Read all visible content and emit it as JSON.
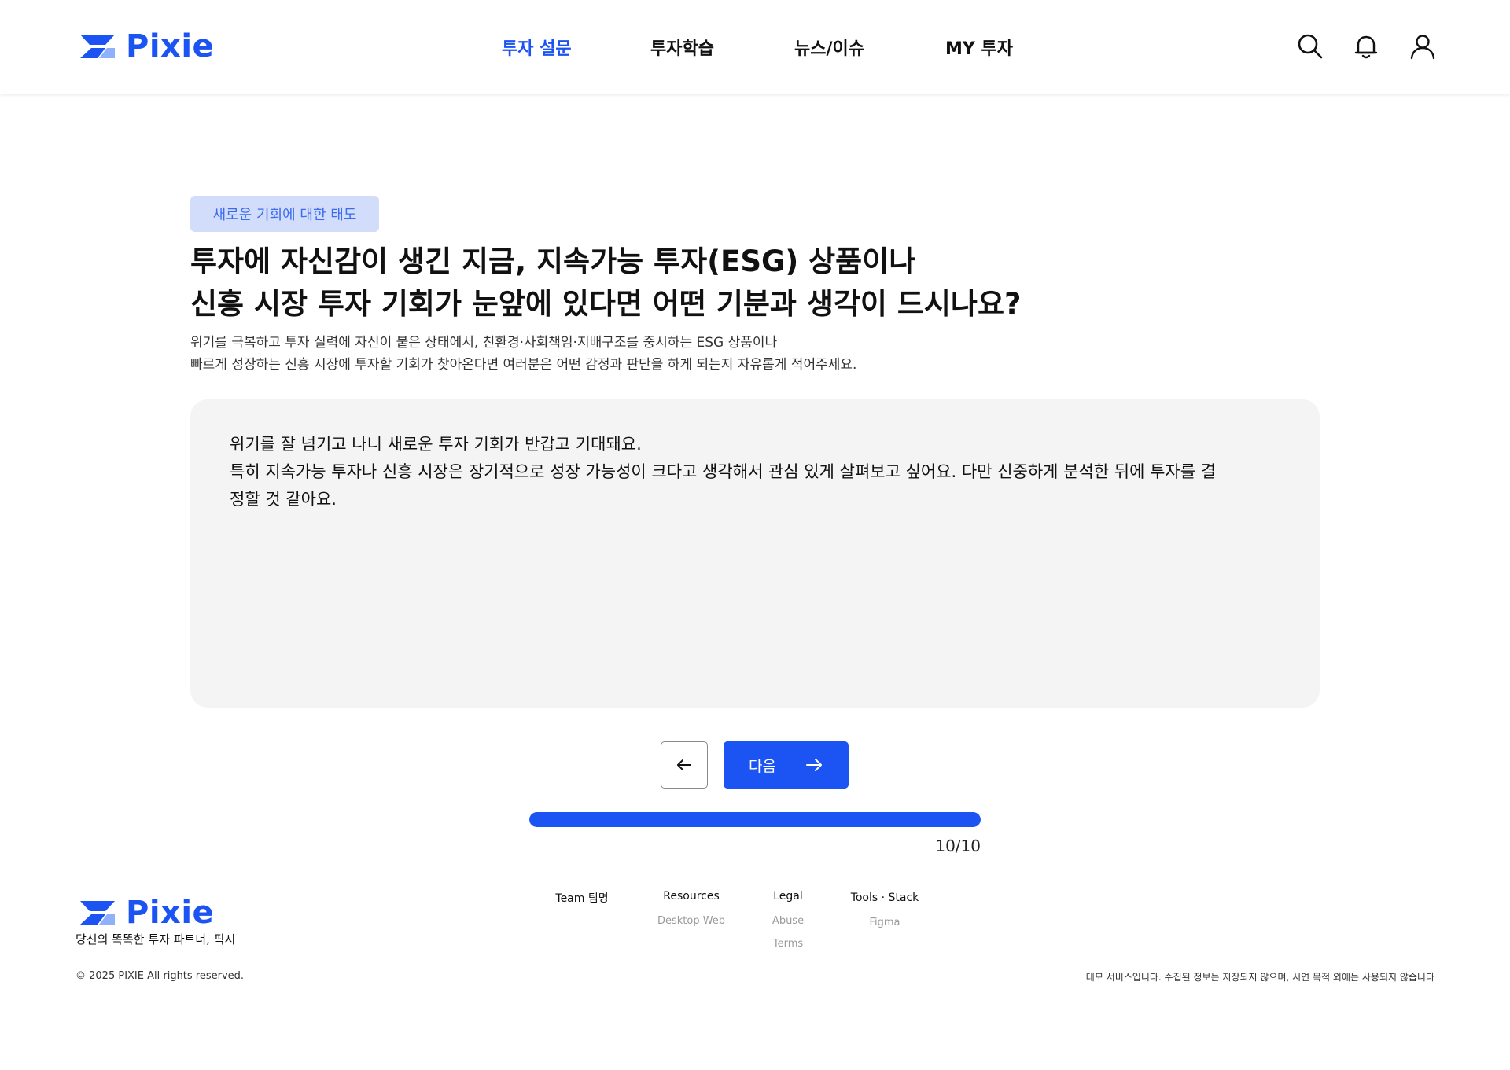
{
  "brand": {
    "name": "Pixie",
    "accent": "#1c54f3",
    "light_accent": "#d2ddfb"
  },
  "nav": {
    "items": [
      {
        "label": "투자 설문",
        "active": true
      },
      {
        "label": "투자학습",
        "active": false
      },
      {
        "label": "뉴스/이슈",
        "active": false
      },
      {
        "label": "MY 투자",
        "active": false
      }
    ],
    "icons": [
      "search-icon",
      "bell-icon",
      "user-icon"
    ]
  },
  "survey": {
    "category": "새로운 기회에 대한 태도",
    "question_line1": "투자에 자신감이 생긴 지금, 지속가능 투자(ESG) 상품이나",
    "question_line2": "신흥 시장 투자 기회가 눈앞에 있다면 어떤 기분과 생각이 드시나요?",
    "desc_line1": "위기를 극복하고 투자 실력에 자신이 붙은 상태에서, 친환경·사회책임·지배구조를 중시하는 ESG 상품이나",
    "desc_line2": "빠르게 성장하는 신흥 시장에 투자할 기회가 찾아온다면 여러분은 어떤 감정과 판단을 하게 되는지 자유롭게 적어주세요.",
    "answer_line1": "위기를 잘 넘기고 나니 새로운 투자 기회가 반갑고 기대돼요.",
    "answer_line2": "특히 지속가능 투자나 신흥 시장은 장기적으로 성장 가능성이 크다고 생각해서 관심 있게 살펴보고 싶어요. 다만 신중하게 분석한 뒤에 투자를 결",
    "answer_line3": "정할 것 같아요.",
    "next_label": "다음",
    "progress": {
      "current": 10,
      "total": 10,
      "label": "10/10"
    }
  },
  "footer": {
    "tagline": "당신의 똑똑한 투자 파트너, 픽시",
    "copyright": "© 2025 PIXIE All rights reserved.",
    "disclaimer": "데모 서비스입니다. 수집된 정보는 저장되지 않으며, 시연 목적 외에는 사용되지 않습니다",
    "columns": [
      {
        "title": "Team 팀명",
        "links": []
      },
      {
        "title": "Resources",
        "links": [
          "Desktop Web"
        ]
      },
      {
        "title": "Legal",
        "links": [
          "Abuse",
          "Terms"
        ]
      },
      {
        "title": "Tools · Stack",
        "links": [
          "Figma"
        ]
      }
    ]
  }
}
